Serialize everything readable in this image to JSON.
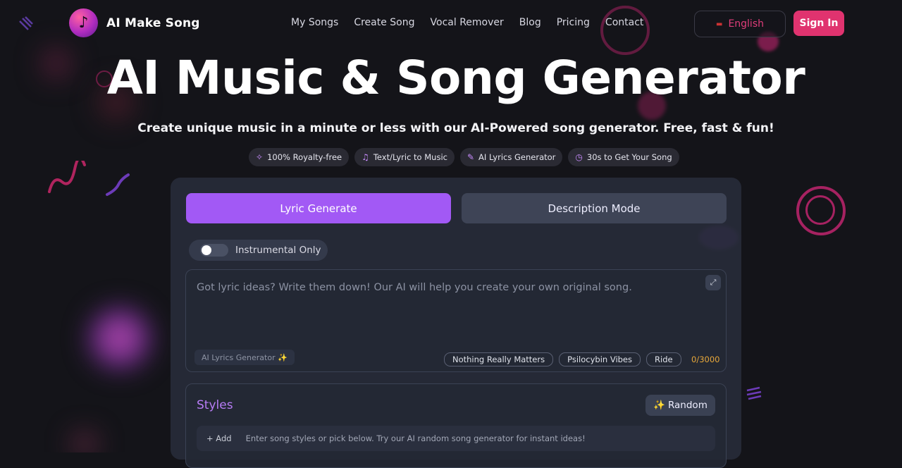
{
  "brand": {
    "name": "AI Make Song"
  },
  "nav": {
    "items": [
      "My Songs",
      "Create Song",
      "Vocal Remover",
      "Blog",
      "Pricing",
      "Contact"
    ]
  },
  "header": {
    "language_label": "English",
    "signin_label": "Sign In"
  },
  "hero": {
    "title": "AI Music & Song Generator",
    "subtitle": "Create unique music in a minute or less with our AI-Powered song generator. Free, fast & fun!",
    "badges": [
      {
        "icon": "sparkle-icon",
        "label": "100% Royalty-free"
      },
      {
        "icon": "music-note-icon",
        "label": "Text/Lyric to Music"
      },
      {
        "icon": "pen-icon",
        "label": "AI Lyrics Generator"
      },
      {
        "icon": "timer-icon",
        "label": "30s to Get Your Song"
      }
    ]
  },
  "generator": {
    "tabs": [
      "Lyric Generate",
      "Description Mode"
    ],
    "instrumental_label": "Instrumental Only",
    "instrumental_on": false,
    "lyrics_placeholder": "Got lyric ideas? Write them down! Our AI will help you create your own original song.",
    "ai_lyrics_button": "AI Lyrics Generator ✨",
    "suggestions": [
      "Nothing Really Matters",
      "Psilocybin Vibes",
      "Ride"
    ],
    "char_counter": "0/3000",
    "styles_title": "Styles",
    "random_label": "Random",
    "add_label": "+ Add",
    "styles_placeholder": "Enter song styles or pick below. Try our AI random song generator for instant ideas!"
  },
  "colors": {
    "accent_purple": "#a259f5",
    "accent_pink": "#e0336f",
    "counter_orange": "#e8a83a"
  }
}
